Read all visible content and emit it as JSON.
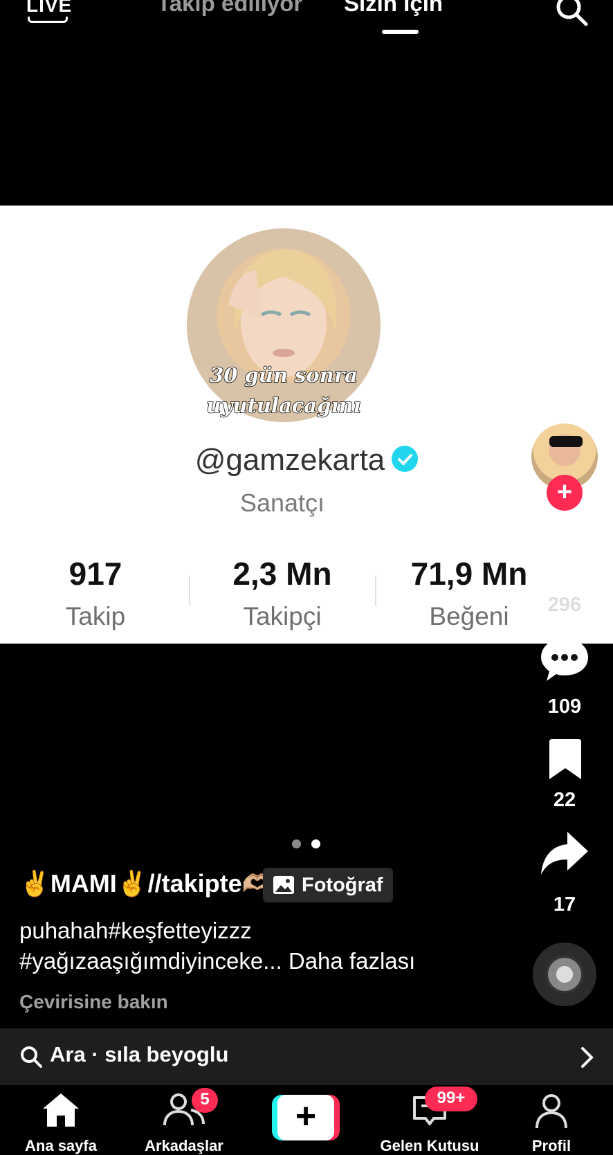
{
  "top_bar": {
    "live_label": "LIVE",
    "tabs": [
      "Takip ediliyor",
      "Sizin İçin"
    ]
  },
  "profile_card": {
    "avatar_caption_line1": "30 gün sonra",
    "avatar_caption_line2": "uyutulacağını",
    "username": "@gamzekarta",
    "role": "Sanatçı",
    "stats": [
      {
        "value": "917",
        "label": "Takip"
      },
      {
        "value": "2,3 Mn",
        "label": "Takipçi"
      },
      {
        "value": "71,9 Mn",
        "label": "Beğeni"
      }
    ]
  },
  "right_rail": {
    "likes": "296",
    "comments": "109",
    "saves": "22",
    "shares": "17"
  },
  "caption": {
    "author": "✌️MAMI✌️//takipte🫶🏼",
    "photo_chip": "Fotoğraf",
    "line1": "puhahah#keşfetteyizzz",
    "line2": "#yağızaaşığımdiyinceke... Daha fazlası",
    "translate": "Çevirisine bakın"
  },
  "search_strip": {
    "text": "Ara · sıla beyoglu"
  },
  "bottom_nav": {
    "items": [
      {
        "label": "Ana sayfa"
      },
      {
        "label": "Arkadaşlar",
        "badge": "5"
      },
      {
        "label": ""
      },
      {
        "label": "Gelen Kutusu",
        "badge": "99+"
      },
      {
        "label": "Profil"
      }
    ]
  },
  "colors": {
    "accent_red": "#fe2c55",
    "accent_cyan": "#25f4ee",
    "verified": "#20d5ec"
  }
}
